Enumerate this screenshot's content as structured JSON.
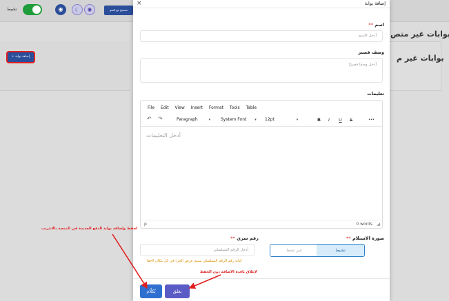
{
  "background": {
    "toggle_label": "نشيط",
    "top_button": "تصحيح مع النمو",
    "add_button": "+ إضافة بوابة",
    "page_title": "بوابات غير متص",
    "card_title": "بوابات غير م"
  },
  "modal": {
    "title": "إضافة بوابة",
    "close_glyph": "×",
    "name": {
      "label": "اسم",
      "required_mark": "**",
      "placeholder": "أدخل الاسم"
    },
    "short_desc": {
      "label": "وصف قصير",
      "placeholder": "أدخل وصفًا قصيرًا"
    },
    "instructions": {
      "label": "تعليمات"
    },
    "editor": {
      "menu": [
        "File",
        "Edit",
        "View",
        "Insert",
        "Format",
        "Tools",
        "Table"
      ],
      "block_format": "Paragraph",
      "font_family": "System Font",
      "font_size": "12pt",
      "bold": "B",
      "italic": "I",
      "underline": "U",
      "strike": "S",
      "more": "•••",
      "undo": "↶",
      "redo": "↷",
      "placeholder": "أدخل التعليمات",
      "status_path": "p",
      "word_count": "0 words"
    },
    "status": {
      "label": "صورة الاستلام",
      "required_mark": "**",
      "active": "نشيط",
      "inactive": "غير نشط"
    },
    "serial": {
      "label": "رقم سري",
      "required_mark": "**",
      "placeholder": "أدخل الرقم التسلسلي",
      "help": "كتابة رقم الرقم التسلسلي سيتم عرض الجزء في كل مكان لاحقا"
    },
    "buttons": {
      "save": "يُكلّام",
      "close": "يغلق"
    }
  },
  "annotations": {
    "save_note": "لحفظ وإضافة بوابة الدفع الجديدة في المنصة بالانترنت",
    "close_note": "لإغلاق نافذة الاضافة دون الحفظ"
  },
  "colors": {
    "primary": "#2f6fd0",
    "secondary": "#5b5bc6",
    "annotation": "#e02020",
    "toggle_green": "#1f9d3a"
  }
}
